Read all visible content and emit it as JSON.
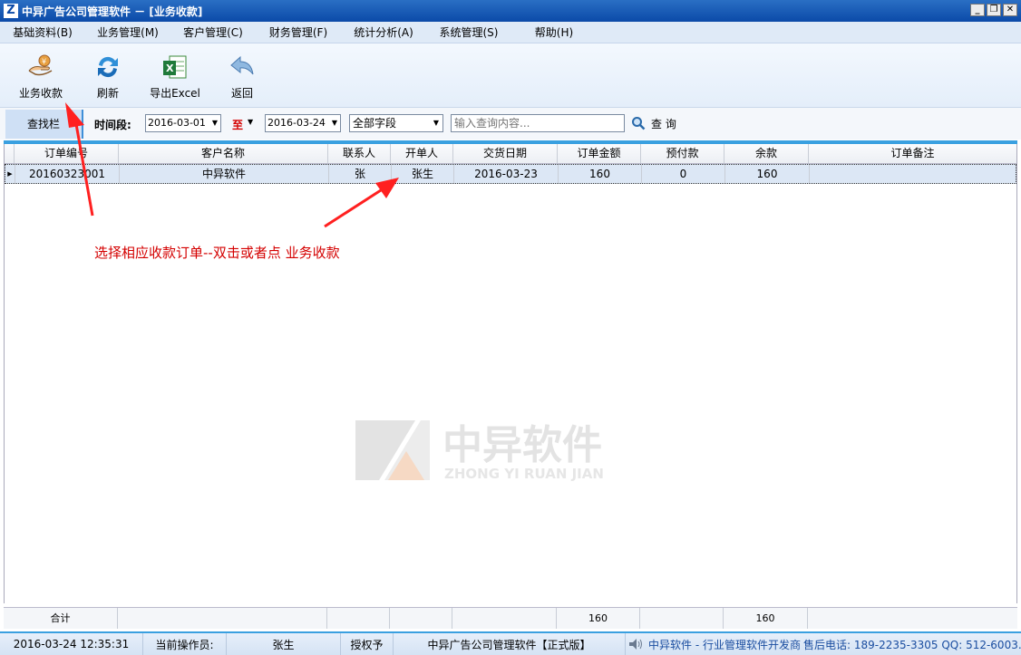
{
  "window": {
    "title": "中异广告公司管理软件 － [业务收款]",
    "logo": "Z",
    "minimize": "_",
    "restore": "❐",
    "close": "✕"
  },
  "menu": [
    {
      "label": "基础资料(B)"
    },
    {
      "label": "业务管理(M)"
    },
    {
      "label": "客户管理(C)"
    },
    {
      "label": "财务管理(F)"
    },
    {
      "label": "统计分析(A)"
    },
    {
      "label": "系统管理(S)"
    },
    {
      "label": "帮助(H)"
    }
  ],
  "toolbar": [
    {
      "label": "业务收款",
      "icon": "payment-hand-icon"
    },
    {
      "label": "刷新",
      "icon": "refresh-icon"
    },
    {
      "label": "导出Excel",
      "icon": "excel-icon"
    },
    {
      "label": "返回",
      "icon": "back-arrow-icon"
    }
  ],
  "search": {
    "tab_label": "查找栏",
    "time_label": "时间段:",
    "date_from": "2016-03-01",
    "to_label": "至",
    "date_to": "2016-03-24",
    "field": "全部字段",
    "query_placeholder": "输入查询内容...",
    "query_button": "查 询"
  },
  "grid": {
    "columns": [
      "订单编号",
      "客户名称",
      "联系人",
      "开单人",
      "交货日期",
      "订单金额",
      "预付款",
      "余款",
      "订单备注"
    ],
    "rows": [
      [
        "20160323001",
        "中异软件",
        "张",
        "张生",
        "2016-03-23",
        "160",
        "0",
        "160",
        ""
      ]
    ]
  },
  "annotation": "选择相应收款订单--双击或者点 业务收款",
  "watermark": {
    "brand": "中异软件",
    "pinyin": "ZHONG YI RUAN JIAN"
  },
  "totals": {
    "label": "合计",
    "order_amount": "160",
    "balance": "160"
  },
  "status": {
    "datetime": "2016-03-24 12:35:31",
    "operator_label": "当前操作员:",
    "operator": "张生",
    "license_label": "授权予",
    "product": "中异广告公司管理软件【正式版】",
    "vendor": "中异软件 - 行业管理软件开发商",
    "contact": "售后电话: 189-2235-3305  QQ: 512-6003..."
  },
  "colors": {
    "accent": "#3aa0e0",
    "title_bar": "#0b4aa8",
    "annotation": "#d40000"
  }
}
